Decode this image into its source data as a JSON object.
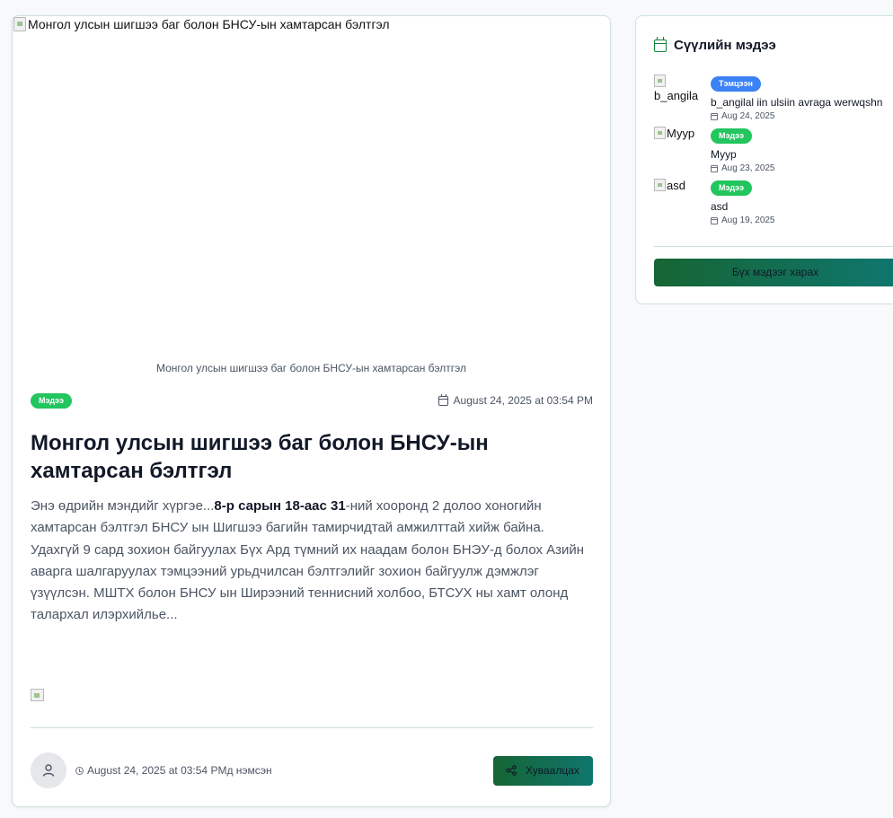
{
  "article": {
    "hero_alt": "Монгол улсын шигшээ баг болон БНСУ-ын хамтарсан бэлтгэл",
    "hero_caption": "Монгол улсын шигшээ баг болон БНСУ-ын хамтарсан бэлтгэл",
    "category_badge": "Мэдээ",
    "date": "August 24, 2025 at 03:54 PM",
    "title": "Монгол улсын шигшээ баг болон БНСУ-ын хамтарсан бэлтгэл",
    "body_intro": "Энэ өдрийн мэндийг хүргэе...",
    "body_bold": "8-р сарын 18-аас 31",
    "body_rest": "-ний хооронд 2 долоо хоногийн хамтарсан бэлтгэл БНСУ ын Шигшээ багийн тамирчидтай амжилттай хийж байна. Удахгүй 9 сард зохион байгуулах Бүх Ард түмний их наадам болон БНЭУ-д болох Азийн аварга шалгаруулах тэмцээний урьдчилсан бэлтгэлийг зохион байгуулж дэмжлэг үзүүлсэн. МШТХ болон БНСУ ын Ширээний теннисний холбоо, БТСУХ ны хамт олонд талархал илэрхийлье...",
    "added_text": "August 24, 2025 at 03:54 PMд нэмсэн",
    "share_label": "Хуваалцах"
  },
  "sidebar": {
    "title": "Сүүлийн мэдээ",
    "items": [
      {
        "thumb_alt": "b_angila",
        "badge": "Тэмцээн",
        "badge_color": "#3b82f6",
        "title": "b_angilal iin ulsiin avraga werwqshn",
        "date": "Aug 24, 2025"
      },
      {
        "thumb_alt": "Муур",
        "badge": "Мэдээ",
        "badge_color": "#22c55e",
        "title": "Муур",
        "date": "Aug 23, 2025"
      },
      {
        "thumb_alt": "asd",
        "badge": "Мэдээ",
        "badge_color": "#22c55e",
        "title": "asd",
        "date": "Aug 19, 2025"
      }
    ],
    "all_news_label": "Бүх мэдээг харах"
  },
  "colors": {
    "accent_green": "#22c55e",
    "accent_blue": "#3b82f6",
    "button_gradient_start": "#166534",
    "button_gradient_end": "#0f766e"
  }
}
